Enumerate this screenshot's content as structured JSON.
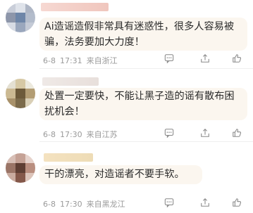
{
  "comments": [
    {
      "text": "Ai造谣造假非常具有迷惑性，很多人容易被骗，法务要加大力度！",
      "date": "6-8",
      "time": "17:31",
      "location": "来自浙江"
    },
    {
      "text": "处置一定要快，不能让黑子造的谣有散布困扰机会！",
      "date": "6-8",
      "time": "17:30",
      "location": "来自江苏"
    },
    {
      "text": "干的漂亮，对造谣者不要手软。",
      "date": "6-8",
      "time": "17:30",
      "location": "来自黑龙江"
    }
  ],
  "icons": {
    "comment": "comment-icon",
    "share": "share-icon",
    "like": "thumbs-up-icon"
  }
}
